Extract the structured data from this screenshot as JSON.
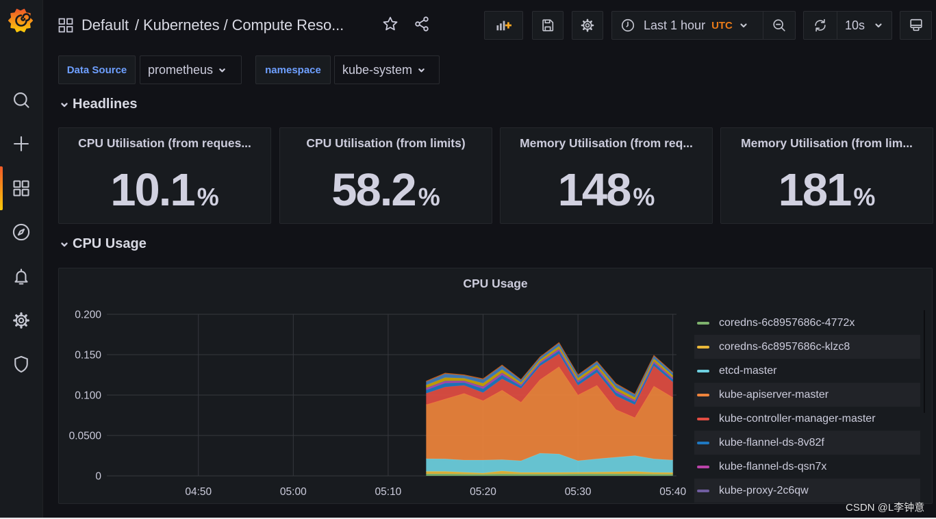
{
  "sidebar": {
    "logo": "grafana-logo",
    "items": [
      {
        "id": "search",
        "icon": "search-icon"
      },
      {
        "id": "create",
        "icon": "plus-icon"
      },
      {
        "id": "dashboards",
        "icon": "apps-icon",
        "active": true
      },
      {
        "id": "explore",
        "icon": "compass-icon"
      },
      {
        "id": "alerting",
        "icon": "bell-icon"
      },
      {
        "id": "configuration",
        "icon": "gear-icon"
      },
      {
        "id": "server-admin",
        "icon": "shield-icon"
      }
    ]
  },
  "header": {
    "folder": "Default",
    "separator": "/",
    "dashboard_title": "Kubernetes / Compute Reso...",
    "icons": [
      "star-icon",
      "share-icon"
    ]
  },
  "toolbar": {
    "buttons": [
      "add-panel-icon",
      "save-icon",
      "gear-icon",
      "zoom-out-icon",
      "refresh-icon",
      "tv-monitor-icon"
    ],
    "time_range": "Last 1 hour",
    "timezone": "UTC",
    "refresh_interval": "10s"
  },
  "variables": [
    {
      "label": "Data Source",
      "value": "prometheus"
    },
    {
      "label": "namespace",
      "value": "kube-system"
    }
  ],
  "rows": [
    {
      "title": "Headlines",
      "collapsed": false
    },
    {
      "title": "CPU Usage",
      "collapsed": false
    }
  ],
  "stats": [
    {
      "title": "CPU Utilisation (from reques...",
      "value": "10.1",
      "unit": "%"
    },
    {
      "title": "CPU Utilisation (from limits)",
      "value": "58.2",
      "unit": "%"
    },
    {
      "title": "Memory Utilisation (from req...",
      "value": "148",
      "unit": "%"
    },
    {
      "title": "Memory Utilisation (from lim...",
      "value": "181",
      "unit": "%"
    }
  ],
  "panels": {
    "cpu_usage": {
      "title": "CPU Usage"
    }
  },
  "colors": {
    "background": "#111217",
    "panel": "#181B1F",
    "timezone_accent": "#EB7B18",
    "variable_label": "#6E9FFF",
    "active_nav": "#F05A28"
  },
  "watermark": "CSDN @L李钟意",
  "chart_data": {
    "type": "area",
    "stacked": true,
    "title": "CPU Usage",
    "xlabel": "",
    "ylabel": "",
    "xlim": [
      "04:40:21",
      "05:40:23"
    ],
    "ylim": [
      0,
      0.2
    ],
    "grid": true,
    "legend": "right",
    "xticks": [
      "04:50",
      "05:00",
      "05:10",
      "05:20",
      "05:30",
      "05:40"
    ],
    "yticks": [
      {
        "value": 0,
        "label": "0"
      },
      {
        "value": 0.05,
        "label": "0.0500"
      },
      {
        "value": 0.1,
        "label": "0.100"
      },
      {
        "value": 0.15,
        "label": "0.150"
      },
      {
        "value": 0.2,
        "label": "0.200"
      }
    ],
    "x": [
      "05:14",
      "05:16",
      "05:18",
      "05:20",
      "05:22",
      "05:24",
      "05:26",
      "05:28",
      "05:30",
      "05:32",
      "05:34",
      "05:36",
      "05:38",
      "05:40"
    ],
    "series": [
      {
        "name": "coredns-6c8957686c-4772x",
        "color": "#7EB26D",
        "values": [
          0.0025,
          0.0025,
          0.0022,
          0.002,
          0.0025,
          0.0022,
          0.0022,
          0.0022,
          0.0025,
          0.0025,
          0.0025,
          0.0025,
          0.0022,
          0.002
        ]
      },
      {
        "name": "coredns-6c8957686c-klzc8",
        "color": "#EAB839",
        "values": [
          0.003,
          0.003,
          0.0022,
          0.0015,
          0.0035,
          0.002,
          0.002,
          0.002,
          0.002,
          0.0022,
          0.0025,
          0.003,
          0.002,
          0.002
        ]
      },
      {
        "name": "etcd-master",
        "color": "#6ED0E0",
        "values": [
          0.0157,
          0.0155,
          0.0151,
          0.016,
          0.014,
          0.0144,
          0.0238,
          0.0228,
          0.0141,
          0.0163,
          0.018,
          0.0195,
          0.0168,
          0.0155
        ]
      },
      {
        "name": "kube-apiserver-master",
        "color": "#EF843C",
        "values": [
          0.0668,
          0.074,
          0.0825,
          0.0735,
          0.086,
          0.0724,
          0.091,
          0.108,
          0.0814,
          0.091,
          0.059,
          0.047,
          0.09,
          0.0775
        ]
      },
      {
        "name": "kube-controller-manager-master",
        "color": "#E24D42",
        "values": [
          0.014,
          0.015,
          0.01,
          0.01,
          0.014,
          0.017,
          0.017,
          0.016,
          0.012,
          0.016,
          0.017,
          0.016,
          0.025,
          0.019
        ]
      },
      {
        "name": "kube-flannel-ds-8v82f",
        "color": "#1F78C1",
        "values": [
          0.0042,
          0.0048,
          0.0036,
          0.0048,
          0.0048,
          0.0031,
          0.0031,
          0.0039,
          0.0036,
          0.0039,
          0.0042,
          0.0036,
          0.0036,
          0.0034
        ]
      },
      {
        "name": "kube-flannel-ds-qsn7x",
        "color": "#BA43A9",
        "values": [
          0.0017,
          0.0019,
          0.0014,
          0.0019,
          0.0019,
          0.0012,
          0.0012,
          0.0015,
          0.0014,
          0.0015,
          0.0017,
          0.0014,
          0.0014,
          0.0013
        ]
      },
      {
        "name": "kube-proxy-2c6qw",
        "color": "#705DA0",
        "values": [
          0.0009,
          0.001,
          0.0008,
          0.001,
          0.001,
          0.0007,
          0.0007,
          0.0008,
          0.0008,
          0.0008,
          0.0009,
          0.0008,
          0.0008,
          0.0007
        ]
      },
      {
        "name": null,
        "color": "#CCA300",
        "values": [
          0.0035,
          0.0039,
          0.003,
          0.0039,
          0.0039,
          0.0025,
          0.0025,
          0.0032,
          0.003,
          0.0032,
          0.0035,
          0.003,
          0.003,
          0.0028
        ]
      },
      {
        "name": null,
        "color": "#447EBC",
        "values": [
          0.0041,
          0.0046,
          0.0035,
          0.0046,
          0.0046,
          0.003,
          0.003,
          0.0038,
          0.0035,
          0.0038,
          0.0041,
          0.0035,
          0.0035,
          0.0032
        ]
      },
      {
        "name": null,
        "color": "#C15C17",
        "values": [
          0.0008,
          0.0009,
          0.0007,
          0.0009,
          0.0009,
          0.0006,
          0.0006,
          0.0007,
          0.0007,
          0.0007,
          0.0008,
          0.0007,
          0.0007,
          0.0006
        ]
      }
    ]
  }
}
